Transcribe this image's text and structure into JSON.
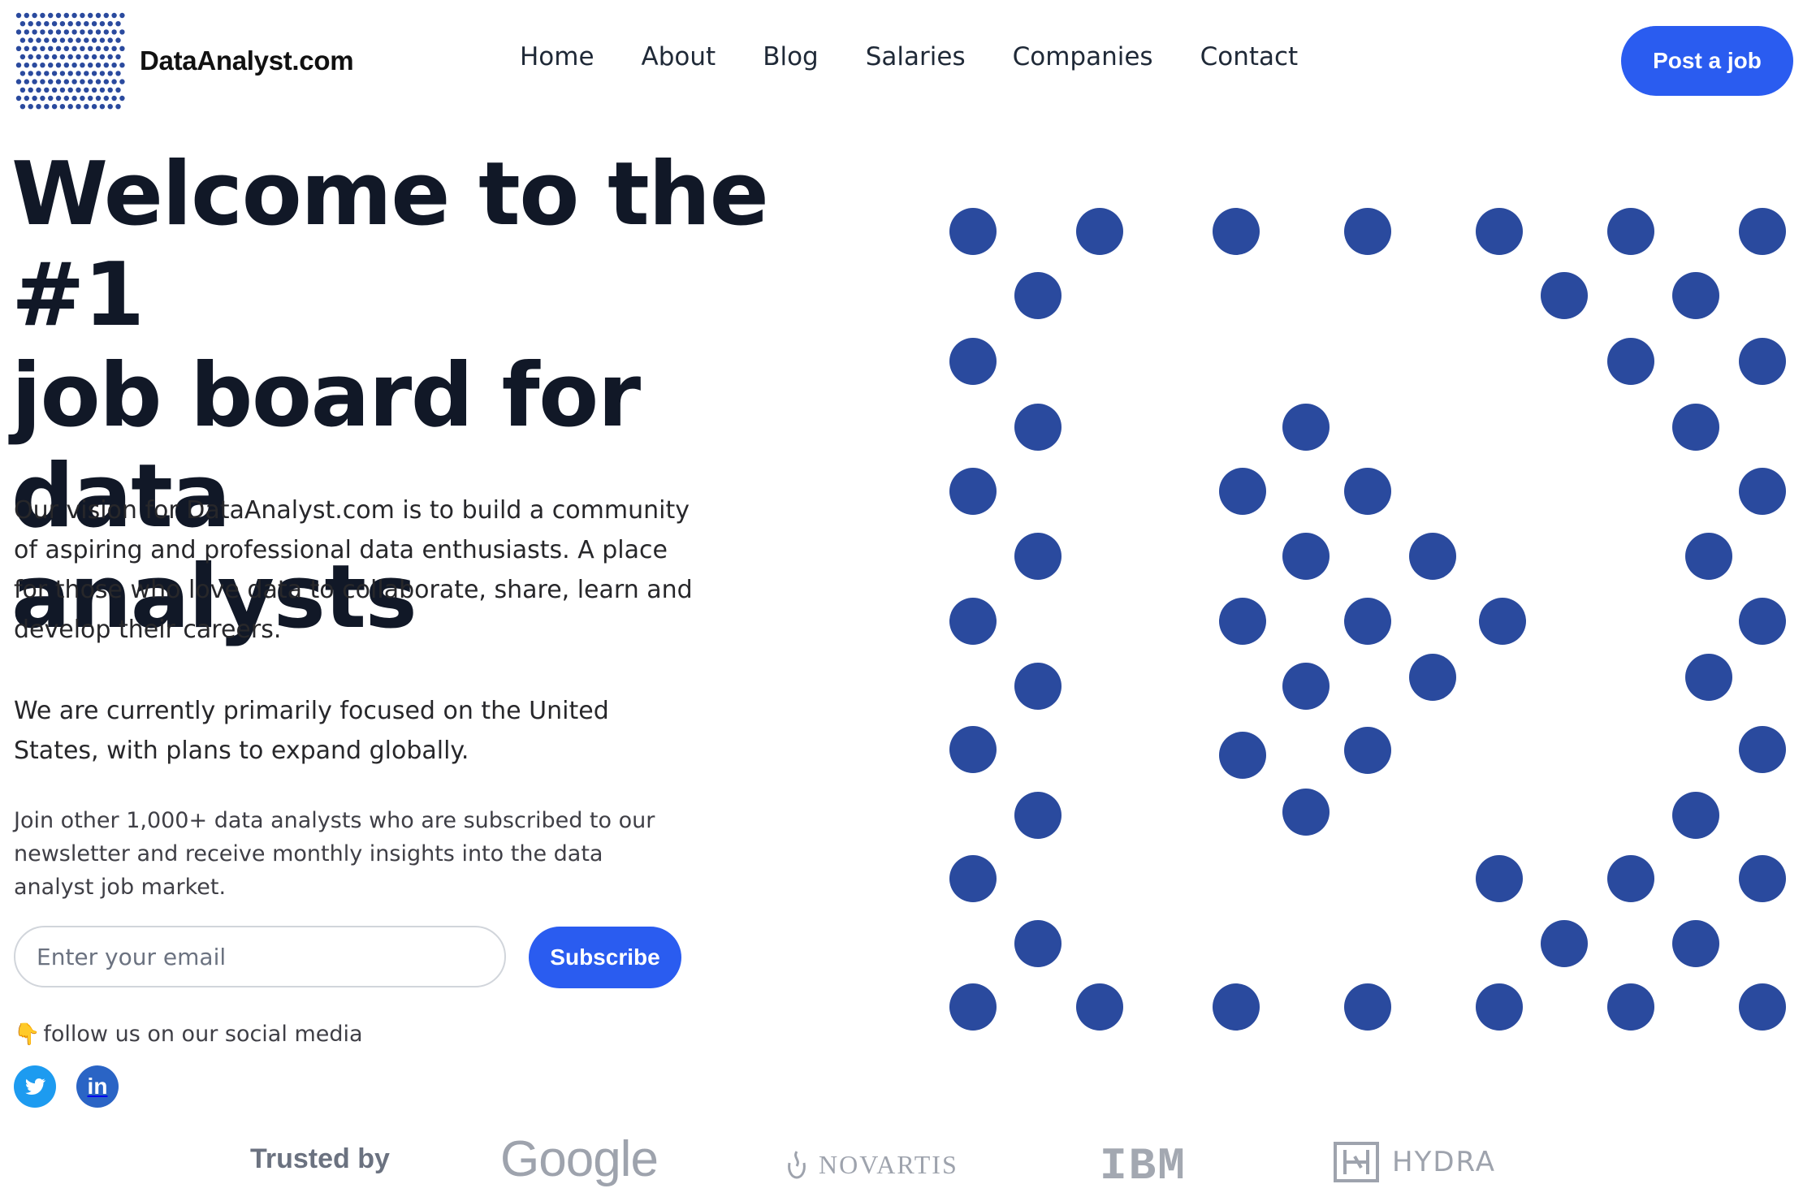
{
  "header": {
    "brand": "DataAnalyst.com",
    "nav": [
      "Home",
      "About",
      "Blog",
      "Salaries",
      "Companies",
      "Contact"
    ],
    "post_job_label": "Post a job"
  },
  "hero": {
    "title_lines": [
      "Welcome to the #1",
      "job board for data",
      "analysts"
    ],
    "paragraph1": "Our vision for DataAnalyst.com is to build a community of aspiring and professional data enthusiasts. A place for those who love data to collaborate, share, learn and develop their careers.",
    "paragraph2": "We are currently primarily focused on the United States, with plans to expand globally.",
    "newsletter_text": "Join other 1,000+ data analysts who are subscribed to our newsletter and receive monthly insights into the data analyst job market."
  },
  "newsletter": {
    "email_placeholder": "Enter your email",
    "subscribe_label": "Subscribe"
  },
  "social": {
    "follow_text": "follow us on our social media",
    "hand_icon": "👇",
    "networks": [
      "twitter-icon",
      "linkedin-icon"
    ]
  },
  "trusted": {
    "label": "Trusted by",
    "brands": [
      "Google",
      "NOVARTIS",
      "IBM",
      "HYDRA"
    ]
  },
  "colors": {
    "accent": "#2a5cf0",
    "dot": "#2a4a9e"
  }
}
